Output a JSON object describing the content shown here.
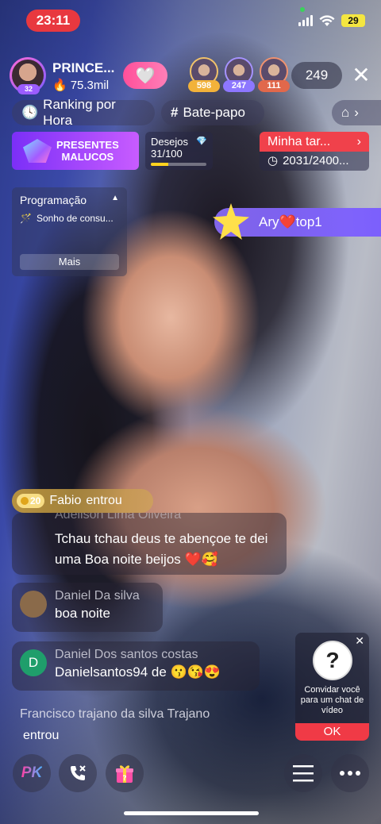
{
  "status_bar": {
    "time": "23:11",
    "battery": "29"
  },
  "host": {
    "name": "PRINCE...",
    "level": "32",
    "stat": "75.3mil"
  },
  "viewers": {
    "top": [
      {
        "score": "598",
        "color": "#f2b23a"
      },
      {
        "score": "247",
        "color": "#8d77ff"
      },
      {
        "score": "111",
        "color": "#e1684b"
      }
    ],
    "count": "249"
  },
  "nav": {
    "ranking": "Ranking por Hora",
    "chat": "Bate-papo"
  },
  "promo": {
    "line1": "PRESENTES",
    "line2": "MALUCOS"
  },
  "wishes": {
    "label": "Desejos",
    "value": "31/100",
    "progress": 0.31
  },
  "task": {
    "title": "Minha tar...",
    "progress": "2031/2400..."
  },
  "schedule": {
    "title": "Programação",
    "item": "Sonho de consu...",
    "more": "Mais"
  },
  "ary": {
    "text": "Ary❤️top1"
  },
  "chat": {
    "entry": {
      "level": "20",
      "name": "Fabio",
      "action": "entrou"
    },
    "messages": [
      {
        "name": "Adeilson Lima Oliveira",
        "text": "Tchau tchau deus te abençoe te dei uma Boa noite beijos ❤️🥰",
        "avatar_color": "#b78a5b"
      },
      {
        "name": "Daniel Da silva",
        "text": "boa noite",
        "avatar_color": "#8a6a4a"
      },
      {
        "name": "Daniel Dos santos costas",
        "text": "Danielsantos94 de 😗😘😍",
        "avatar_letter": "D",
        "avatar_color": "#1f9e6b"
      }
    ],
    "joined": {
      "name": "Francisco trajano da silva Trajano",
      "action": "entrou"
    }
  },
  "invite": {
    "text": "Convidar você para um chat de vídeo",
    "ok": "OK"
  },
  "bottom": {
    "pk": "PK"
  }
}
